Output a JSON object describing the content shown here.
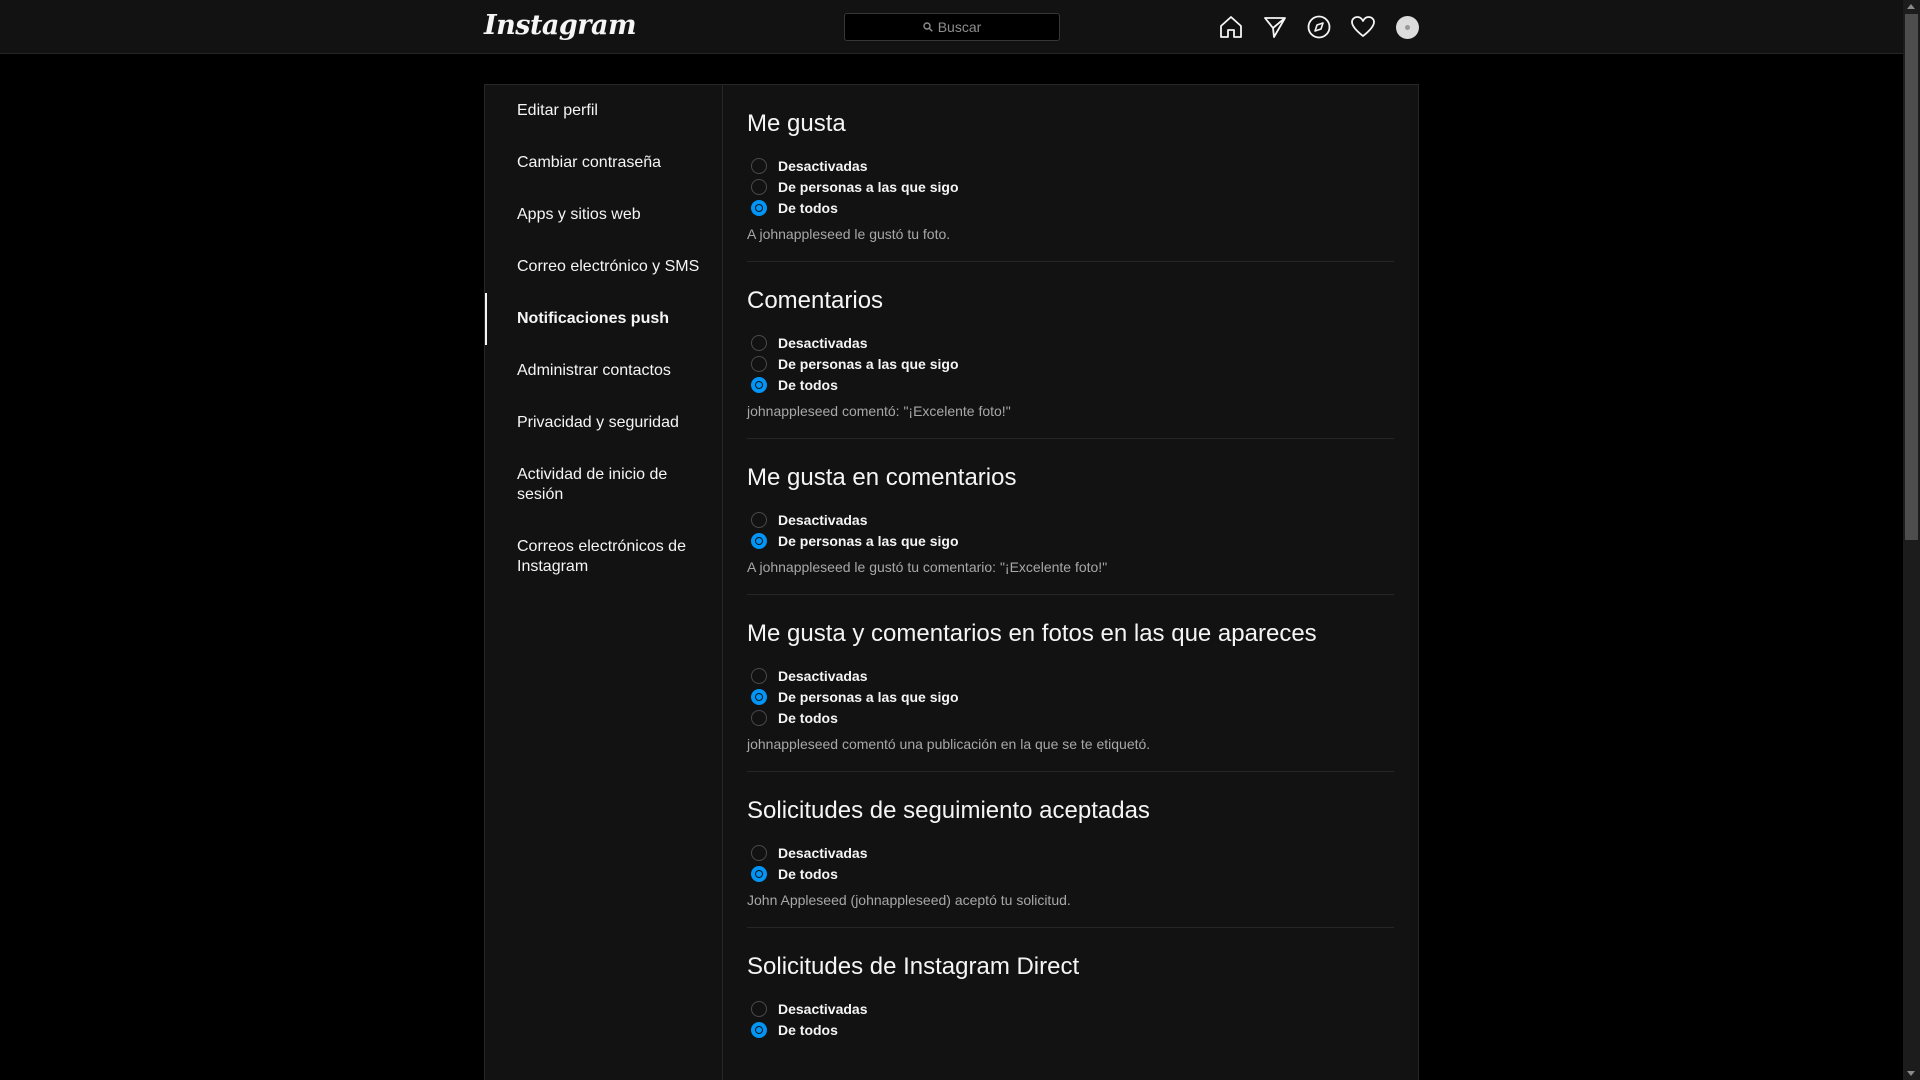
{
  "header": {
    "logo": "Instagram",
    "search_placeholder": "Buscar",
    "icons": [
      "home-icon",
      "direct-icon",
      "explore-icon",
      "activity-heart-icon",
      "profile-avatar"
    ]
  },
  "sidebar": {
    "items": [
      {
        "label": "Editar perfil",
        "active": false
      },
      {
        "label": "Cambiar contraseña",
        "active": false
      },
      {
        "label": "Apps y sitios web",
        "active": false
      },
      {
        "label": "Correo electrónico y SMS",
        "active": false
      },
      {
        "label": "Notificaciones push",
        "active": true
      },
      {
        "label": "Administrar contactos",
        "active": false
      },
      {
        "label": "Privacidad y seguridad",
        "active": false
      },
      {
        "label": "Actividad de inicio de sesión",
        "active": false
      },
      {
        "label": "Correos electrónicos de Instagram",
        "active": false
      }
    ]
  },
  "sections": [
    {
      "title": "Me gusta",
      "options": [
        {
          "label": "Desactivadas",
          "checked": false
        },
        {
          "label": "De personas a las que sigo",
          "checked": false
        },
        {
          "label": "De todos",
          "checked": true
        }
      ],
      "example": "A johnappleseed le gustó tu foto."
    },
    {
      "title": "Comentarios",
      "options": [
        {
          "label": "Desactivadas",
          "checked": false
        },
        {
          "label": "De personas a las que sigo",
          "checked": false
        },
        {
          "label": "De todos",
          "checked": true
        }
      ],
      "example": "johnappleseed comentó: \"¡Excelente foto!\""
    },
    {
      "title": "Me gusta en comentarios",
      "options": [
        {
          "label": "Desactivadas",
          "checked": false
        },
        {
          "label": "De personas a las que sigo",
          "checked": true
        }
      ],
      "example": "A johnappleseed le gustó tu comentario: \"¡Excelente foto!\""
    },
    {
      "title": "Me gusta y comentarios en fotos en las que apareces",
      "options": [
        {
          "label": "Desactivadas",
          "checked": false
        },
        {
          "label": "De personas a las que sigo",
          "checked": true
        },
        {
          "label": "De todos",
          "checked": false
        }
      ],
      "example": "johnappleseed comentó una publicación en la que se te etiquetó."
    },
    {
      "title": "Solicitudes de seguimiento aceptadas",
      "options": [
        {
          "label": "Desactivadas",
          "checked": false
        },
        {
          "label": "De todos",
          "checked": true
        }
      ],
      "example": "John Appleseed (johnappleseed) aceptó tu solicitud."
    },
    {
      "title": "Solicitudes de Instagram Direct",
      "options": [
        {
          "label": "Desactivadas",
          "checked": false
        },
        {
          "label": "De todos",
          "checked": true
        }
      ],
      "example": ""
    }
  ],
  "colors": {
    "accent": "#0095f6",
    "background": "#000000",
    "panel": "#121212",
    "border": "#262626",
    "secondary_text": "#a8a8a8"
  }
}
